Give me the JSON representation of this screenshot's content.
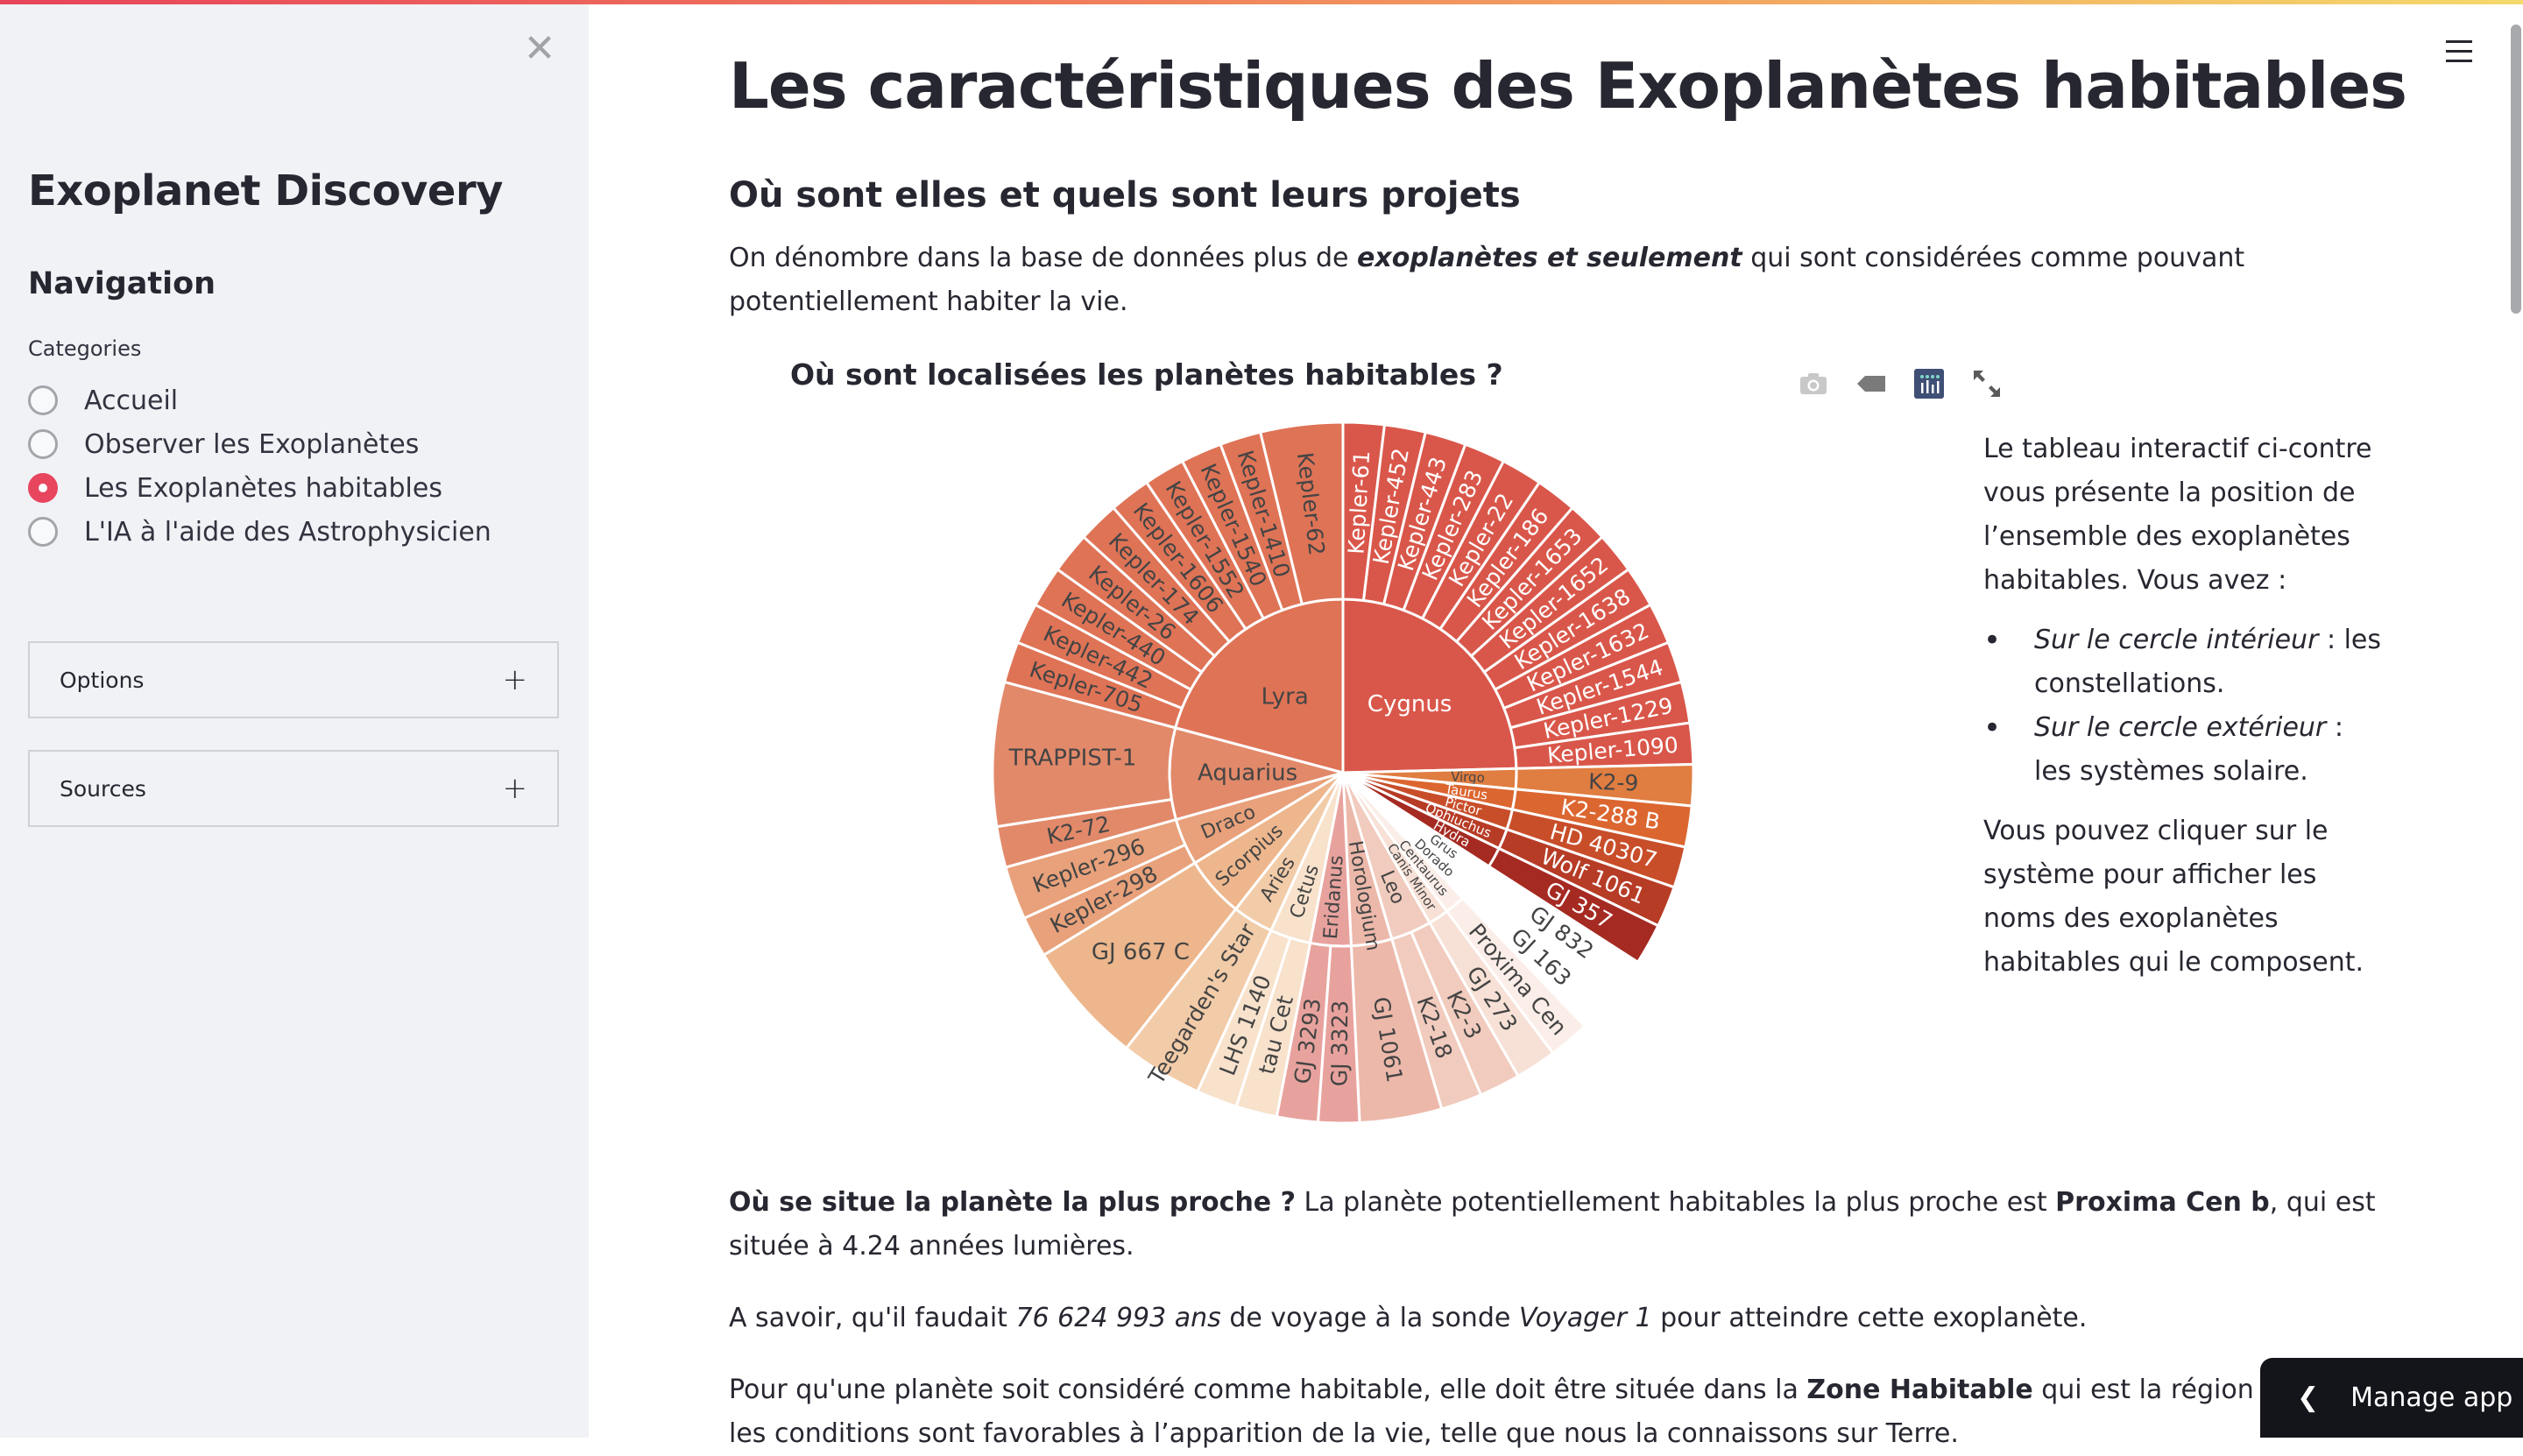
{
  "sidebar": {
    "close_icon": "close-icon",
    "app_title": "Exoplanet Discovery",
    "nav_title": "Navigation",
    "categories_label": "Categories",
    "radio_options": [
      {
        "label": "Accueil",
        "selected": false
      },
      {
        "label": "Observer les Exoplanètes",
        "selected": false
      },
      {
        "label": "Les Exoplanètes habitables",
        "selected": true
      },
      {
        "label": "L'IA à l'aide des Astrophysicien",
        "selected": false
      }
    ],
    "expanders": [
      {
        "label": "Options",
        "icon": "plus-icon"
      },
      {
        "label": "Sources",
        "icon": "plus-icon"
      }
    ],
    "accent_color": "#e8455f"
  },
  "main": {
    "title": "Les caractéristiques des Exoplanètes habitables",
    "subtitle": "Où sont elles et quels sont leurs projets",
    "intro": {
      "before": "On dénombre dans la base de données plus de ",
      "emphasis": "exoplanètes et seulement",
      "after": " qui sont considérées comme pouvant potentiellement habiter la vie."
    },
    "side_text": {
      "p1": "Le tableau interactif ci-contre vous présente la position de l’ensemble des exoplanètes habitables. Vous avez :",
      "bullets": [
        {
          "em": "Sur le cercle intérieur",
          "rest": " : les constellations."
        },
        {
          "em": "Sur le cercle extérieur",
          "rest": " : les systèmes solaire."
        }
      ],
      "p2": "Vous pouvez cliquer sur le système pour afficher les noms des exoplanètes habitables qui le composent."
    },
    "nearest": {
      "q": "Où se situe la planète la plus proche ?",
      "t1": " La planète potentiellement habitables la plus proche est ",
      "planet": "Proxima Cen b",
      "t2": ", qui est située à 4.24 années lumières."
    },
    "voyager": {
      "t1": "A savoir, qu'il faudait ",
      "years": "76 624 993 ans",
      "t2": " de voyage à la sonde ",
      "probe": "Voyager 1",
      "t3": " pour atteindre cette exoplanète."
    },
    "habitable_zone": {
      "t1": "Pour qu'une planète soit considéré comme habitable, elle doit être située dans la ",
      "zone": "Zone Habitable",
      "t2": " qui est la région de l’esp",
      "line2": "les conditions sont favorables à l’apparition de la vie, telle que nous la connaissons sur Terre."
    }
  },
  "modebar": {
    "buttons": [
      {
        "name": "camera-icon",
        "title": "Download plot as png"
      },
      {
        "name": "tag-icon",
        "title": "Show hover labels"
      },
      {
        "name": "plotly-logo-icon",
        "title": "Produced with Plotly"
      },
      {
        "name": "fullscreen-icon",
        "title": "Expand"
      }
    ]
  },
  "header": {
    "menu_icon": "hamburger-icon"
  },
  "manage_app": {
    "label": "Manage app",
    "icon": "chevron-left-icon"
  },
  "chart_data": {
    "type": "sunburst",
    "title": "Où sont localisées les planètes habitables ?",
    "rings": [
      "constellation",
      "system"
    ],
    "series": [
      {
        "name": "Cygnus",
        "color": "#d9574a",
        "children": [
          {
            "name": "Kepler-61",
            "value": 1
          },
          {
            "name": "Kepler-452",
            "value": 1
          },
          {
            "name": "Kepler-443",
            "value": 1
          },
          {
            "name": "Kepler-283",
            "value": 1
          },
          {
            "name": "Kepler-22",
            "value": 1
          },
          {
            "name": "Kepler-186",
            "value": 1
          },
          {
            "name": "Kepler-1653",
            "value": 1
          },
          {
            "name": "Kepler-1652",
            "value": 1
          },
          {
            "name": "Kepler-1638",
            "value": 1
          },
          {
            "name": "Kepler-1632",
            "value": 1
          },
          {
            "name": "Kepler-1544",
            "value": 1
          },
          {
            "name": "Kepler-1229",
            "value": 1
          },
          {
            "name": "Kepler-1090",
            "value": 1
          }
        ]
      },
      {
        "name": "Virgo",
        "color": "#e07d40",
        "children": [
          {
            "name": "K2-9",
            "value": 1
          }
        ]
      },
      {
        "name": "Taurus",
        "color": "#dc6630",
        "children": [
          {
            "name": "K2-288 B",
            "value": 1
          }
        ]
      },
      {
        "name": "Pictor",
        "color": "#c84e2a",
        "children": [
          {
            "name": "HD 40307",
            "value": 1
          }
        ]
      },
      {
        "name": "Ophiuchus",
        "color": "#b73c26",
        "children": [
          {
            "name": "Wolf 1061",
            "value": 1
          }
        ]
      },
      {
        "name": "Hydra",
        "color": "#a52a22",
        "children": [
          {
            "name": "GJ 357",
            "value": 1
          }
        ]
      },
      {
        "name": "Grus",
        "color": "#ffffff",
        "children": [
          {
            "name": "GJ 832",
            "value": 1
          }
        ]
      },
      {
        "name": "Dorado",
        "color": "#ffffff",
        "children": [
          {
            "name": "GJ 163",
            "value": 1
          }
        ]
      },
      {
        "name": "Centaurus",
        "color": "#fbeee8",
        "children": [
          {
            "name": "Proxima Cen",
            "value": 1
          }
        ]
      },
      {
        "name": "Canis Minor",
        "color": "#f7e1d6",
        "children": [
          {
            "name": "GJ 273",
            "value": 1
          }
        ]
      },
      {
        "name": "Leo",
        "color": "#f1cbbd",
        "children": [
          {
            "name": "K2-3",
            "value": 1
          },
          {
            "name": "K2-18",
            "value": 1
          }
        ]
      },
      {
        "name": "Horologium",
        "color": "#ecb8aa",
        "children": [
          {
            "name": "GJ 1061",
            "value": 2
          }
        ]
      },
      {
        "name": "Eridanus",
        "color": "#e8a29d",
        "children": [
          {
            "name": "GJ 3323",
            "value": 1
          },
          {
            "name": "GJ 3293",
            "value": 1
          }
        ]
      },
      {
        "name": "Cetus",
        "color": "#f8e2cc",
        "children": [
          {
            "name": "tau Cet",
            "value": 1
          },
          {
            "name": "LHS 1140",
            "value": 1
          }
        ]
      },
      {
        "name": "Aries",
        "color": "#f2cba8",
        "children": [
          {
            "name": "Teegarden's Star",
            "value": 2
          }
        ]
      },
      {
        "name": "Scorpius",
        "color": "#edb68c",
        "children": [
          {
            "name": "GJ 667 C",
            "value": 3
          }
        ]
      },
      {
        "name": "Draco",
        "color": "#e8a17a",
        "children": [
          {
            "name": "Kepler-298",
            "value": 1
          },
          {
            "name": "Kepler-296",
            "value": 1.3
          }
        ]
      },
      {
        "name": "Aquarius",
        "color": "#e2896a",
        "children": [
          {
            "name": "K2-72",
            "value": 1
          },
          {
            "name": "TRAPPIST-1",
            "value": 3.5
          }
        ]
      },
      {
        "name": "Lyra",
        "color": "#df7356",
        "children": [
          {
            "name": "Kepler-705",
            "value": 1
          },
          {
            "name": "Kepler-442",
            "value": 1
          },
          {
            "name": "Kepler-440",
            "value": 1
          },
          {
            "name": "Kepler-26",
            "value": 1
          },
          {
            "name": "Kepler-174",
            "value": 1
          },
          {
            "name": "Kepler-1606",
            "value": 1
          },
          {
            "name": "Kepler-1552",
            "value": 1
          },
          {
            "name": "Kepler-1540",
            "value": 1
          },
          {
            "name": "Kepler-1410",
            "value": 1
          },
          {
            "name": "Kepler-62",
            "value": 2
          }
        ]
      }
    ],
    "white_text_constellations": [
      "Cygnus",
      "Taurus",
      "Pictor",
      "Ophiuchus",
      "Hydra"
    ]
  }
}
